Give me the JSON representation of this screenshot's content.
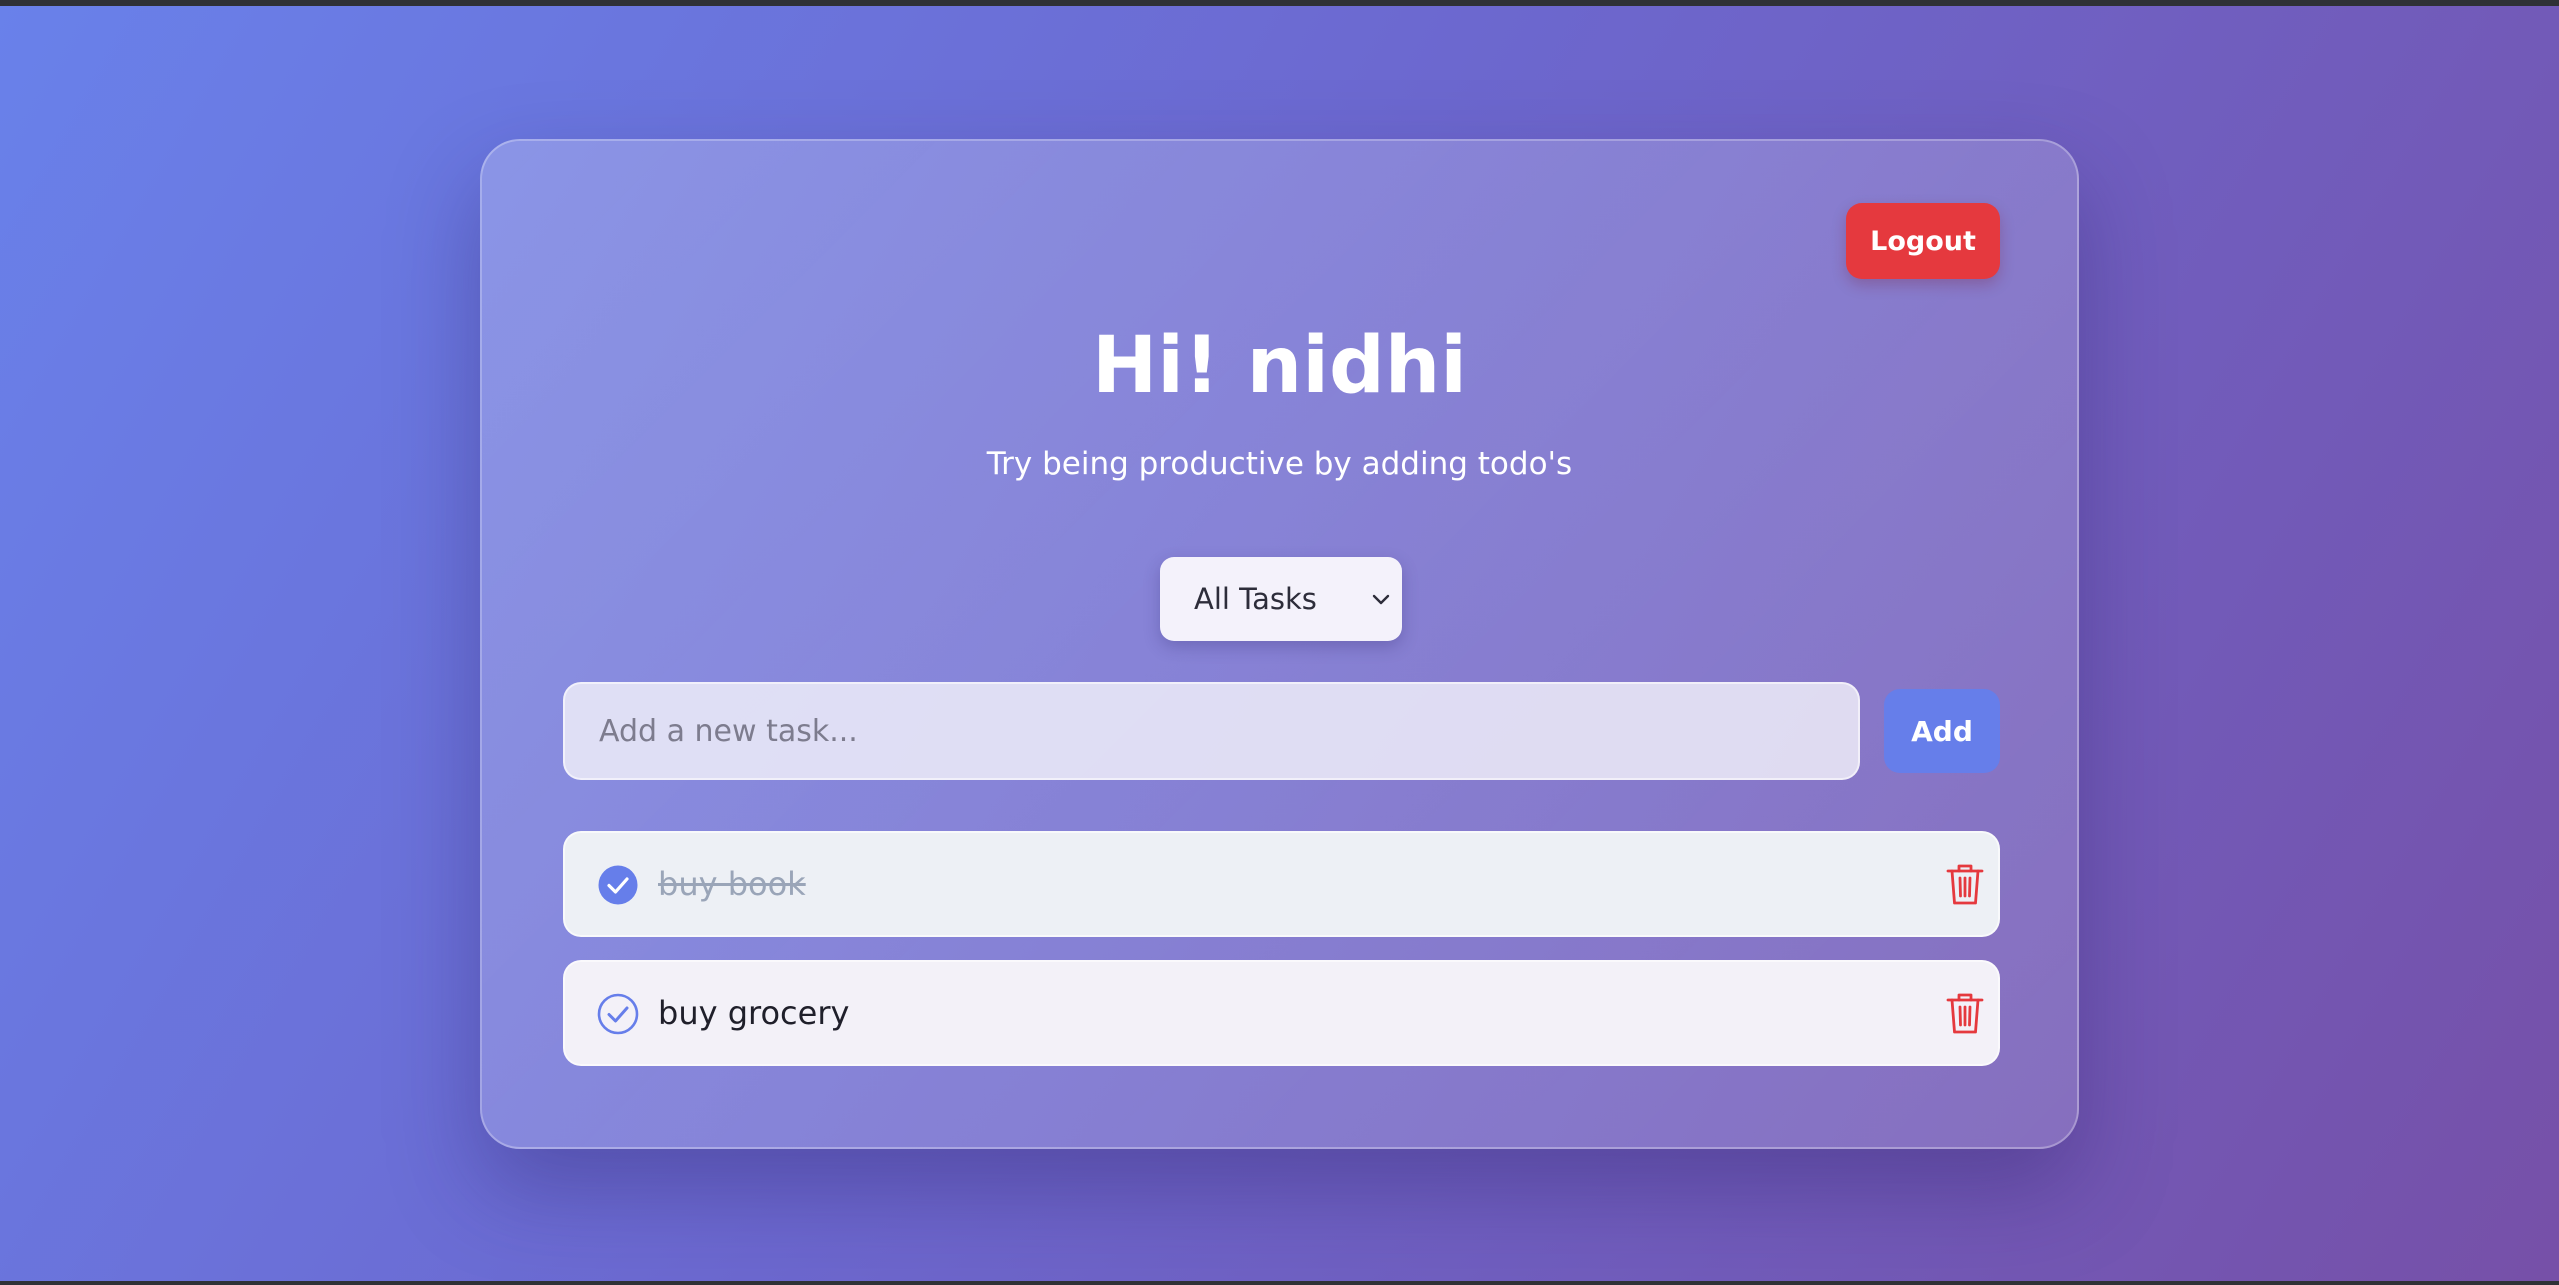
{
  "header": {
    "logout_label": "Logout",
    "title": "Hi! nidhi",
    "subtitle": "Try being productive by adding todo's"
  },
  "filter": {
    "selected": "All Tasks"
  },
  "new_task": {
    "placeholder": "Add a new task...",
    "value": "",
    "add_label": "Add"
  },
  "tasks": [
    {
      "label": "buy book",
      "completed": true
    },
    {
      "label": "buy grocery",
      "completed": false
    }
  ],
  "icons": {
    "check": "check-circle-icon",
    "delete": "trash-icon",
    "dropdown": "chevron-down-icon"
  },
  "colors": {
    "accent": "#667eea",
    "danger": "#e5393e",
    "completed_text": "#9aa5b8"
  }
}
